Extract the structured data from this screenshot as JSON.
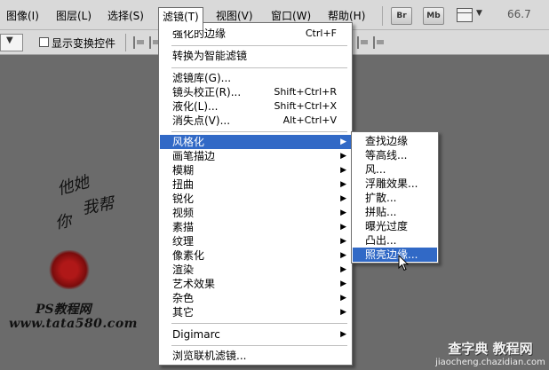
{
  "menubar": {
    "items": [
      "图像(I)",
      "图层(L)",
      "选择(S)",
      "滤镜(T)",
      "视图(V)",
      "窗口(W)",
      "帮助(H)"
    ],
    "active_index": 3,
    "bridge_label": "Br",
    "minibridge_label": "Mb",
    "zoom": "66.7"
  },
  "options": {
    "show_transform_label": "显示变换控件"
  },
  "filter_menu": {
    "items": [
      {
        "label": "强化的边缘",
        "shortcut": "Ctrl+F"
      },
      {
        "label": "转换为智能滤镜"
      },
      {
        "label": "滤镜库(G)..."
      },
      {
        "label": "镜头校正(R)...",
        "shortcut": "Shift+Ctrl+R"
      },
      {
        "label": "液化(L)...",
        "shortcut": "Shift+Ctrl+X"
      },
      {
        "label": "消失点(V)...",
        "shortcut": "Alt+Ctrl+V"
      },
      {
        "label": "风格化",
        "submenu": true,
        "highlighted": true
      },
      {
        "label": "画笔描边",
        "submenu": true
      },
      {
        "label": "模糊",
        "submenu": true
      },
      {
        "label": "扭曲",
        "submenu": true
      },
      {
        "label": "锐化",
        "submenu": true
      },
      {
        "label": "视频",
        "submenu": true
      },
      {
        "label": "素描",
        "submenu": true
      },
      {
        "label": "纹理",
        "submenu": true
      },
      {
        "label": "像素化",
        "submenu": true
      },
      {
        "label": "渲染",
        "submenu": true
      },
      {
        "label": "艺术效果",
        "submenu": true
      },
      {
        "label": "杂色",
        "submenu": true
      },
      {
        "label": "其它",
        "submenu": true
      },
      {
        "label": "Digimarc",
        "submenu": true
      },
      {
        "label": "浏览联机滤镜..."
      }
    ]
  },
  "stylize_submenu": {
    "items": [
      "查找边缘",
      "等高线...",
      "风...",
      "浮雕效果...",
      "扩散...",
      "拼贴...",
      "曝光过度",
      "凸出...",
      "照亮边缘..."
    ],
    "highlighted_index": 8
  },
  "watermark": {
    "calligraphy_1": "他她",
    "calligraphy_2": "我帮",
    "calligraphy_3": "你",
    "calligraphy_4": "",
    "site_name": "PS教程网",
    "site_url": "www.tata580.com",
    "corner_brand": "查字典 教程网",
    "corner_url": "jiaocheng.chazidian.com"
  },
  "colors": {
    "highlight": "#3169c6",
    "canvas": "#6b6b6b",
    "menubar": "#d9d9d9"
  }
}
